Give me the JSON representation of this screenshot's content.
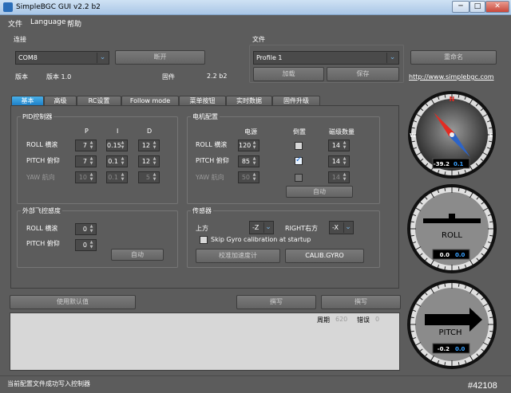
{
  "window": {
    "title": "SimpleBGC GUI v2.2 b2",
    "min": "─",
    "max": "□",
    "close": "✕"
  },
  "menu": [
    "文件",
    "Language",
    "帮助"
  ],
  "connection": {
    "title": "连接",
    "port": "COM8",
    "disconnect": "断开",
    "version_label": "版本",
    "version_value": "版本 1.0",
    "firmware_label": "固件",
    "firmware_value": "2.2 b2"
  },
  "file": {
    "title": "文件",
    "profile": "Profile 1",
    "rename": "重命名",
    "load": "加载",
    "save": "保存",
    "link": "http://www.simplebgc.com"
  },
  "tabs": [
    "基本",
    "高级",
    "RC设置",
    "Follow mode",
    "菜单按钮",
    "实时数据",
    "固件升级"
  ],
  "pid": {
    "title": "PID控制器",
    "headers": [
      "P",
      "I",
      "D"
    ],
    "rows": [
      {
        "label": "ROLL 横滚",
        "p": "7",
        "i": "0.15",
        "d": "12"
      },
      {
        "label": "PITCH 俯仰",
        "p": "7",
        "i": "0.1",
        "d": "12"
      },
      {
        "label": "YAW 航向",
        "p": "10",
        "i": "0.1",
        "d": "5"
      }
    ]
  },
  "motor": {
    "title": "电机配置",
    "headers": [
      "电源",
      "倒置",
      "磁级数量"
    ],
    "rows": [
      {
        "label": "ROLL 横滚",
        "power": "120",
        "poles": "14"
      },
      {
        "label": "PITCH 俯仰",
        "power": "85",
        "poles": "14"
      },
      {
        "label": "YAW 航向",
        "power": "50",
        "poles": "14"
      }
    ],
    "auto": "自动"
  },
  "external": {
    "title": "外部飞控感度",
    "roll": "ROLL 横滚",
    "roll_value": "0",
    "pitch": "PITCH 俯仰",
    "pitch_value": "0",
    "auto": "自动"
  },
  "sensor": {
    "title": "传感器",
    "top_label": "上方",
    "top_value": "-Z",
    "right_label": "RIGHT右方",
    "right_value": "-X",
    "skip_gyro": "Skip Gyro calibration at startup",
    "calib_acc": "校准加速度计",
    "calib_gyro": "CALIB.GYRO"
  },
  "bottom_buttons": {
    "defaults": "使用默认值",
    "read": "撰写",
    "write": "撰写"
  },
  "log": {
    "cycle_label": "周期",
    "cycle_value": "620",
    "error_label": "错误",
    "error_value": "0"
  },
  "status": "当前配置文件成功写入控制器",
  "watermark": "#42108",
  "gauges": {
    "compass": {
      "n": "N",
      "w": "W",
      "e": "E",
      "value": "-39.2",
      "value2": "0.1",
      "heading": -39.2
    },
    "roll": {
      "label": "ROLL",
      "value": "0.0",
      "value2": "0.0"
    },
    "pitch": {
      "label": "PITCH",
      "value": "-0.2",
      "value2": "0.0"
    }
  }
}
